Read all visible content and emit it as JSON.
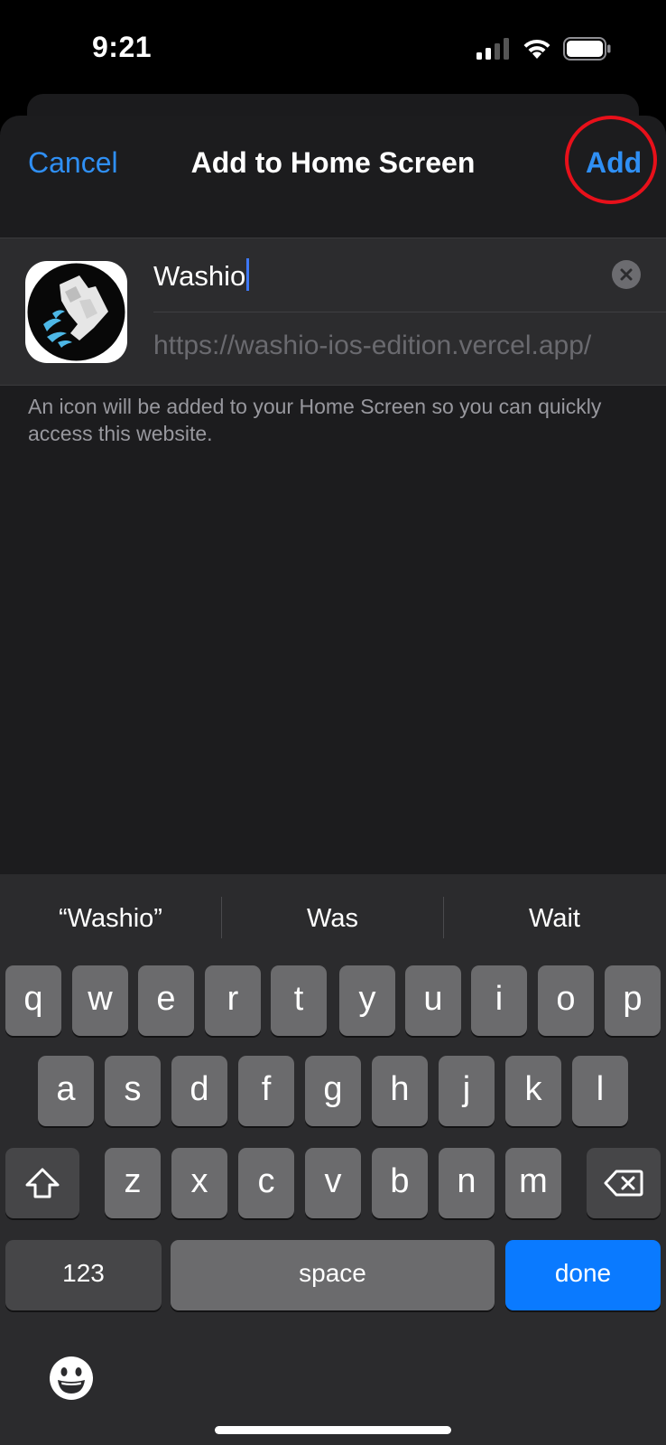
{
  "status_bar": {
    "time": "9:21",
    "icons": [
      "signal-icon",
      "wifi-icon",
      "battery-icon"
    ]
  },
  "sheet": {
    "cancel_label": "Cancel",
    "title": "Add to Home Screen",
    "add_label": "Add",
    "highlight_color": "#e8101a",
    "accent_color": "#2f8ff4"
  },
  "form": {
    "name_value": "Washio",
    "url": "https://washio-ios-edition.vercel.app/",
    "app_icon": "washio-logo-icon"
  },
  "description": "An icon will be added to your Home Screen so you can quickly access this website.",
  "keyboard": {
    "suggestions": [
      "“Washio”",
      "Was",
      "Wait"
    ],
    "row1": [
      "q",
      "w",
      "e",
      "r",
      "t",
      "y",
      "u",
      "i",
      "o",
      "p"
    ],
    "row2": [
      "a",
      "s",
      "d",
      "f",
      "g",
      "h",
      "j",
      "k",
      "l"
    ],
    "row3": [
      "z",
      "x",
      "c",
      "v",
      "b",
      "n",
      "m"
    ],
    "numbers_label": "123",
    "space_label": "space",
    "done_label": "done",
    "done_color": "#0a7aff",
    "icons": [
      "shift-icon",
      "backspace-icon",
      "emoji-icon"
    ]
  }
}
